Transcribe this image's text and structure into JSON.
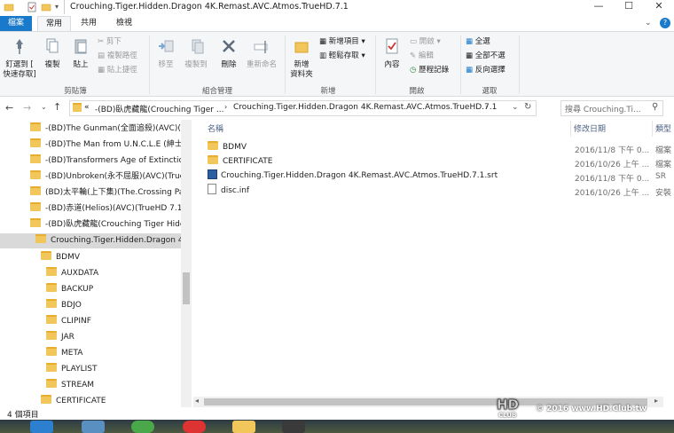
{
  "window": {
    "title": "Crouching.Tiger.Hidden.Dragon 4K.Remast.AVC.Atmos.TrueHD.7.1"
  },
  "tabs": [
    {
      "label": "檔案"
    },
    {
      "label": "常用"
    },
    {
      "label": "共用"
    },
    {
      "label": "檢視"
    }
  ],
  "ribbon": {
    "clipboard": {
      "pin_label_1": "釘選到 [",
      "pin_label_2": "快速存取]",
      "copy": "複製",
      "paste": "貼上",
      "cut": "剪下",
      "copy_path": "複製路徑",
      "paste_shortcut": "貼上捷徑",
      "group": "剪貼簿"
    },
    "organize": {
      "move_to": "移至",
      "copy_to": "複製到",
      "delete": "刪除",
      "rename": "重新命名",
      "group": "組合管理"
    },
    "new": {
      "new_folder_1": "新增",
      "new_folder_2": "資料夾",
      "new_item": "新增項目",
      "easy_access": "輕鬆存取",
      "group": "新增"
    },
    "open": {
      "properties": "內容",
      "open": "開啟",
      "edit": "編輯",
      "history": "歷程記錄",
      "group": "開啟"
    },
    "select": {
      "select_all": "全選",
      "select_none": "全部不選",
      "invert": "反向選擇",
      "group": "選取"
    }
  },
  "address": {
    "chevron": "«",
    "crumb1": "-(BD)臥虎藏龍(Crouching Tiger ...",
    "crumb2": "Crouching.Tiger.Hidden.Dragon 4K.Remast.AVC.Atmos.TrueHD.7.1",
    "search_placeholder": "搜尋 Crouching.Ti..."
  },
  "nav": {
    "items": [
      {
        "label": "-(BD)The Gunman(全面追殺)(AVC)(Tr"
      },
      {
        "label": "-(BD)The Man from U.N.C.L.E (紳士密"
      },
      {
        "label": "-(BD)Transformers Age of Extinction("
      },
      {
        "label": "-(BD)Unbroken(永不屈服)(AVC)(TrueH"
      },
      {
        "label": "(BD)太平輪(上下集)(The.Crossing Part"
      },
      {
        "label": "-(BD)赤道(Helios)(AVC)(TrueHD 7.1)("
      },
      {
        "label": "-(BD)臥虎藏龍(Crouching Tiger Hidd"
      },
      {
        "label": "Crouching.Tiger.Hidden.Dragon 4K"
      },
      {
        "label": "BDMV"
      },
      {
        "label": "AUXDATA"
      },
      {
        "label": "BACKUP"
      },
      {
        "label": "BDJO"
      },
      {
        "label": "CLIPINF"
      },
      {
        "label": "JAR"
      },
      {
        "label": "META"
      },
      {
        "label": "PLAYLIST"
      },
      {
        "label": "STREAM"
      },
      {
        "label": "CERTIFICATE"
      }
    ]
  },
  "columns": {
    "name": "名稱",
    "date": "修改日期",
    "type": "類型"
  },
  "files": [
    {
      "name": "BDMV",
      "date": "2016/11/8 下午 0...",
      "type": "檔案"
    },
    {
      "name": "CERTIFICATE",
      "date": "2016/10/26 上午 ...",
      "type": "檔案"
    },
    {
      "name": "Crouching.Tiger.Hidden.Dragon 4K.Remast.AVC.Atmos.TrueHD.7.1.srt",
      "date": "2016/11/8 下午 0...",
      "type": "SR"
    },
    {
      "name": "disc.inf",
      "date": "2016/10/26 上午 ...",
      "type": "安裝"
    }
  ],
  "status": {
    "count": "4 個項目"
  },
  "watermark": {
    "text": "© 2016 www.HD.Club.tw"
  }
}
